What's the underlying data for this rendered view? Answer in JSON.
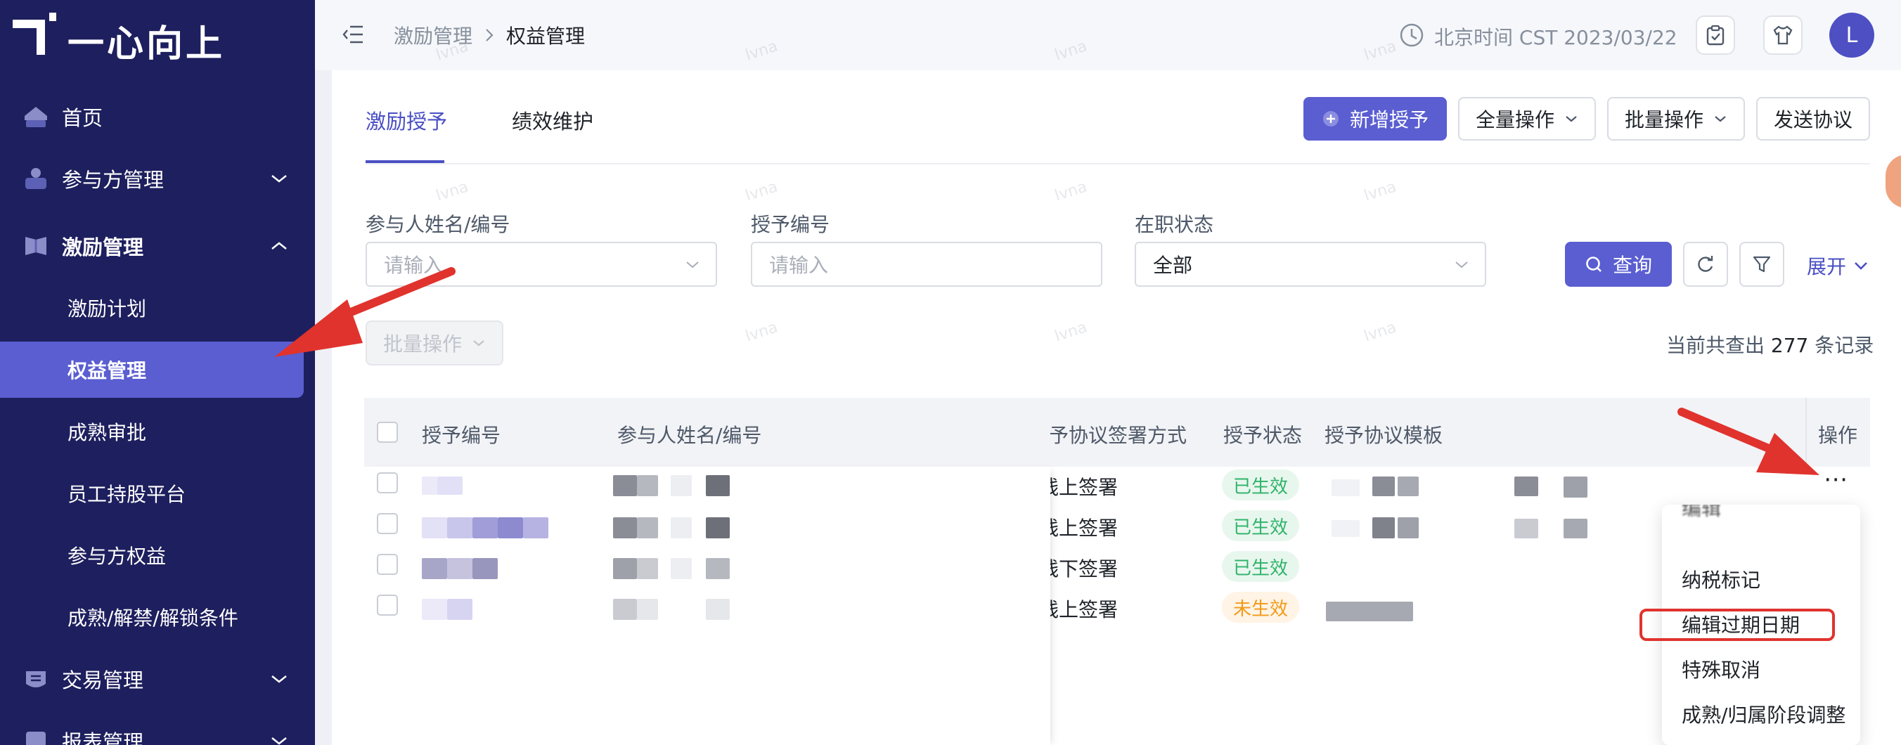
{
  "app": {
    "brand": "一心向上"
  },
  "sidebar": {
    "items": [
      {
        "label": "首页",
        "icon": "home-icon"
      },
      {
        "label": "参与方管理",
        "icon": "participant-icon"
      },
      {
        "label": "激励管理",
        "icon": "incentive-icon",
        "expanded": true
      },
      {
        "label": "交易管理",
        "icon": "transaction-icon"
      },
      {
        "label": "报表管理",
        "icon": "report-icon"
      }
    ],
    "subitems": [
      {
        "label": "激励计划"
      },
      {
        "label": "权益管理",
        "active": true
      },
      {
        "label": "成熟审批"
      },
      {
        "label": "员工持股平台"
      },
      {
        "label": "参与方权益"
      },
      {
        "label": "成熟/解禁/解锁条件"
      }
    ]
  },
  "header": {
    "breadcrumb": [
      "激励管理",
      "权益管理"
    ],
    "time": "北京时间 CST 2023/03/22",
    "avatar": "L"
  },
  "tabs": [
    {
      "label": "激励授予",
      "active": true
    },
    {
      "label": "绩效维护"
    }
  ],
  "actions": {
    "new_grant": "新增授予",
    "all_ops": "全量操作",
    "batch_ops": "批量操作",
    "send_agreement": "发送协议"
  },
  "filters": {
    "participant_label": "参与人姓名/编号",
    "participant_placeholder": "请输入",
    "grant_no_label": "授予编号",
    "grant_no_placeholder": "请输入",
    "status_label": "在职状态",
    "status_value": "全部",
    "query": "查询",
    "expand": "展开"
  },
  "batch_button": "批量操作",
  "total": {
    "prefix": "当前共查出",
    "count": "277",
    "suffix": "条记录"
  },
  "table": {
    "columns": [
      "授予编号",
      "参与人姓名/编号",
      "授予协议签署方式",
      "授予状态",
      "授予协议模板",
      "操作"
    ],
    "rows": [
      {
        "sign": "线上签署",
        "status": "已生效",
        "status_type": "ok"
      },
      {
        "sign": "线上签署",
        "status": "已生效",
        "status_type": "ok"
      },
      {
        "sign": "线下签署",
        "status": "已生效",
        "status_type": "ok"
      },
      {
        "sign": "线上签署",
        "status": "未生效",
        "status_type": "no"
      }
    ]
  },
  "more_icon": "⋯",
  "row_menu": {
    "items": [
      "编辑",
      "纳税标记",
      "编辑过期日期",
      "特殊取消",
      "成熟/归属阶段调整"
    ]
  },
  "watermark": "lvna",
  "colors": {
    "sidebar": "#1e1f5e",
    "primary": "#5a5ed1",
    "annotation": "#e0332e"
  }
}
